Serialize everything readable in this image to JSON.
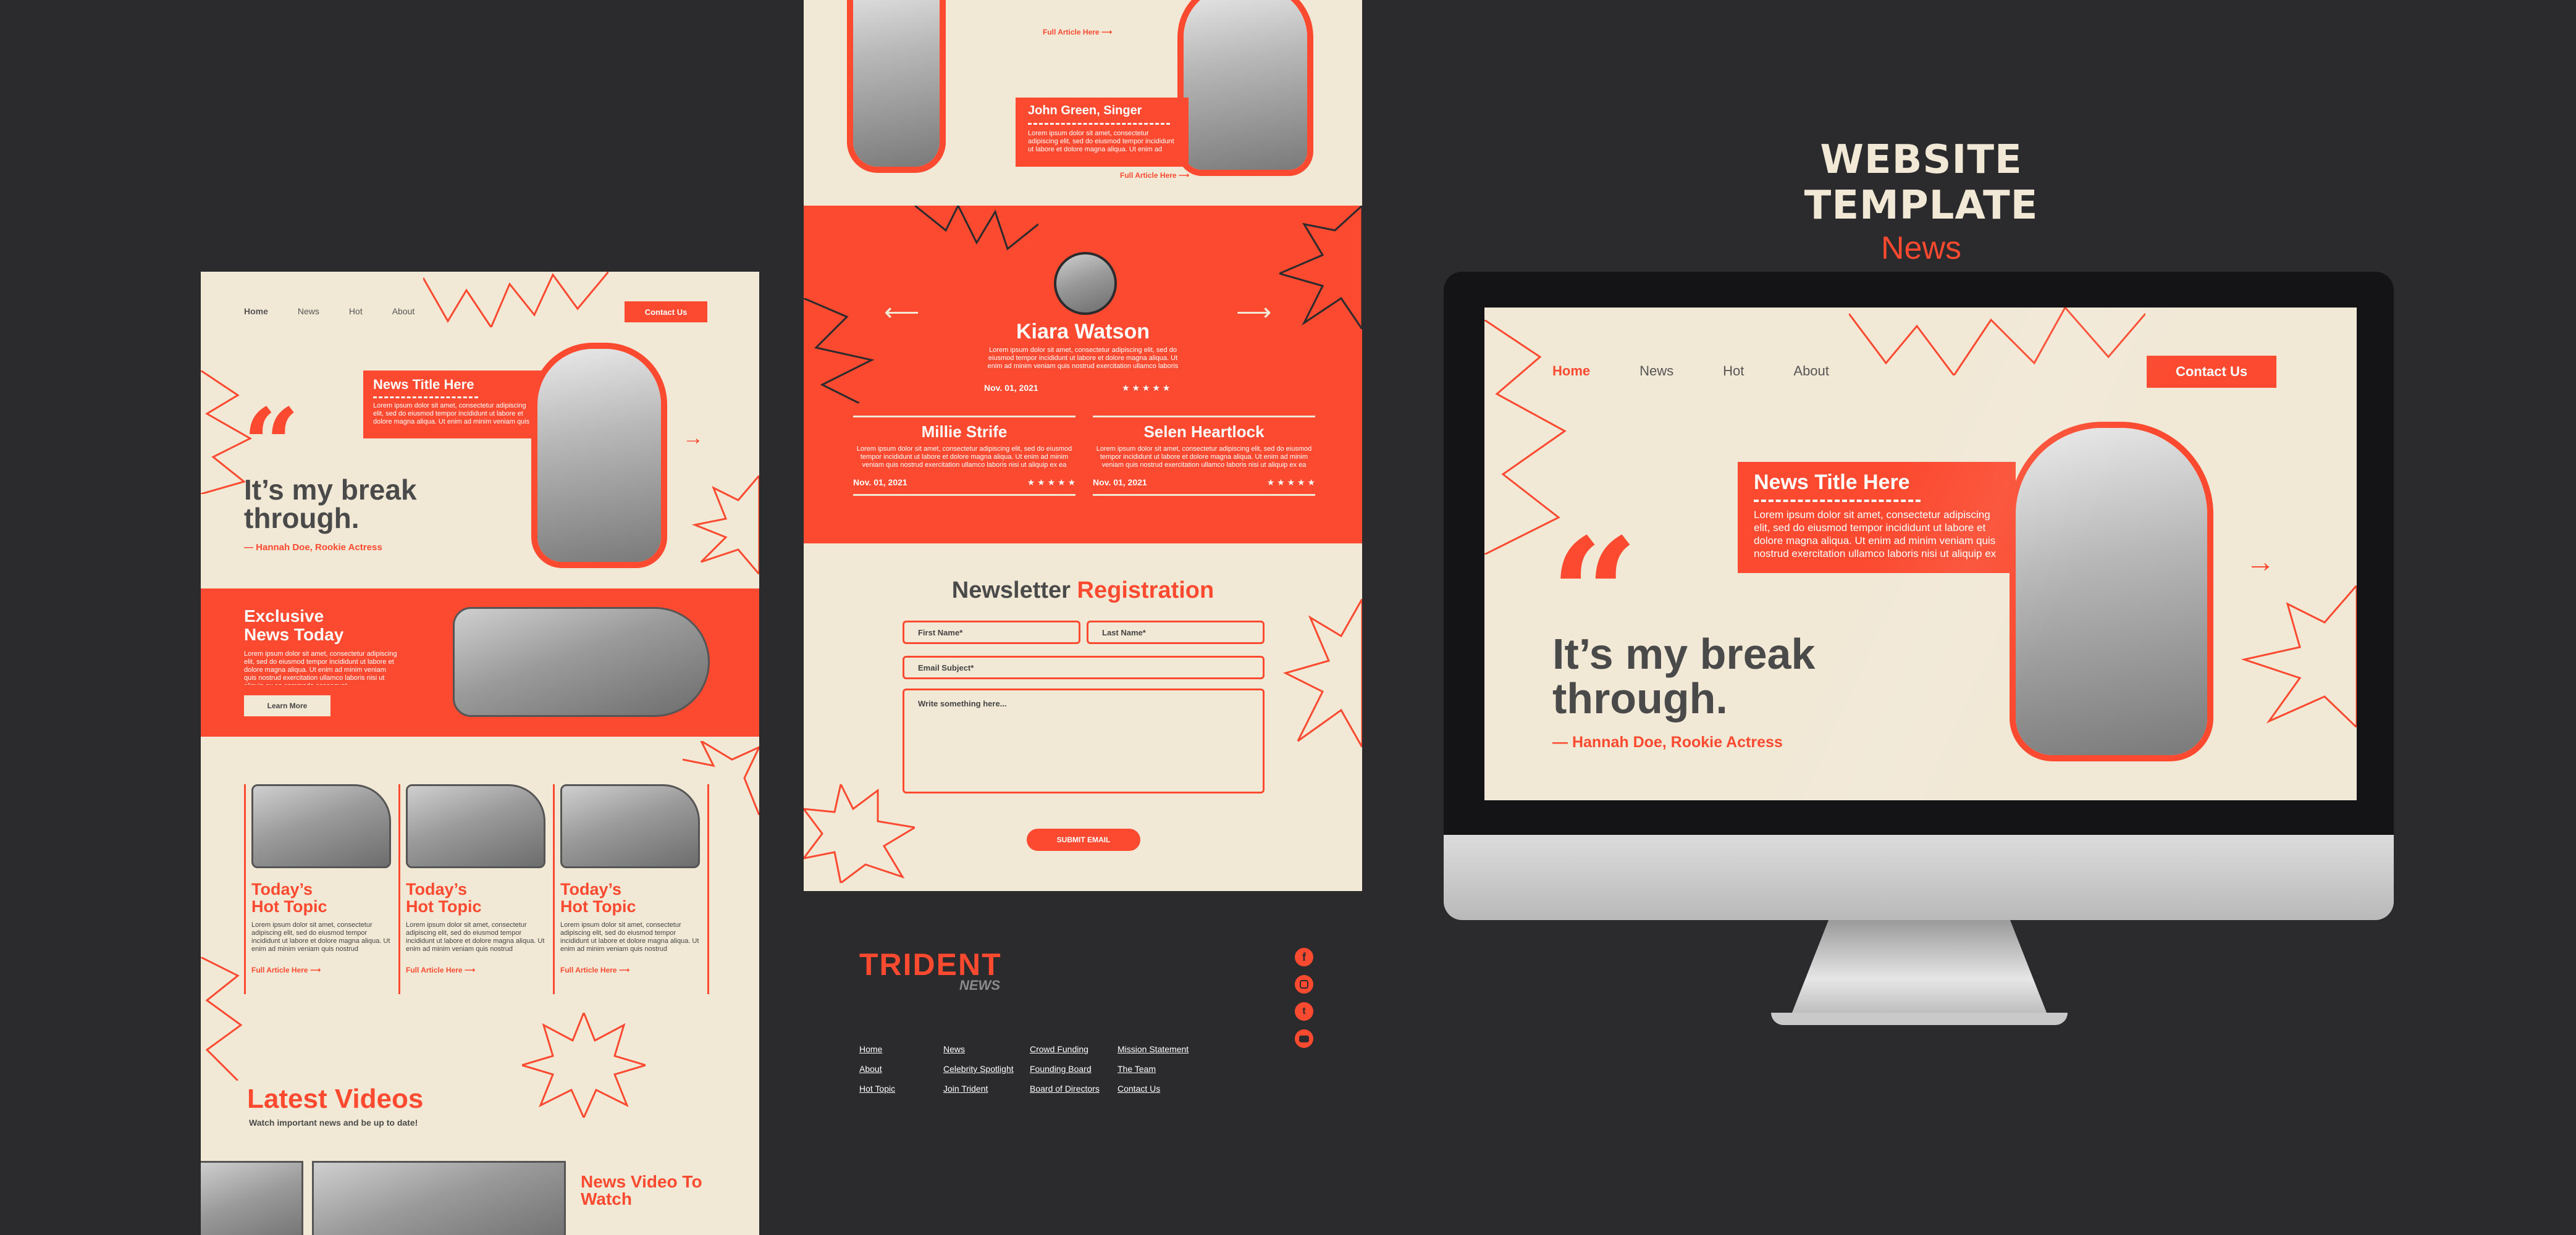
{
  "title": {
    "main": "WEBSITE TEMPLATE",
    "sub": "News"
  },
  "colors": {
    "accent": "#fb4a30",
    "cream": "#f1e8d6",
    "dark": "#2b2a2d"
  },
  "left": {
    "nav": [
      "Home",
      "News",
      "Hot",
      "About"
    ],
    "contact": "Contact Us",
    "news_title": "News Title Here",
    "lorem": "Lorem ipsum dolor sit amet, consectetur adipiscing elit, sed do eiusmod tempor incididunt ut labore et dolore magna aliqua. Ut enim ad minim veniam quis nostrud exercitation ullamco laboris nisi ut aliquip ex ea commodo consequat.",
    "quote_mark": "“",
    "quote": "It’s my break through.",
    "attribution": "— Hannah Doe, Rookie Actress",
    "exclusive_title": "Exclusive News Today",
    "learn_more": "Learn More",
    "hot_topics": [
      {
        "title": "Today’s Hot Topic",
        "link": "Full Article Here"
      },
      {
        "title": "Today’s Hot Topic",
        "link": "Full Article Here"
      },
      {
        "title": "Today’s Hot Topic",
        "link": "Full Article Here"
      }
    ],
    "latest_videos": "Latest Videos",
    "latest_sub": "Watch important news and be up to date!",
    "video_title": "News Video To Watch"
  },
  "middle": {
    "top_link_1": "Full Article Here",
    "singer": "John Green, Singer",
    "top_link_2": "Full Article Here",
    "testimonial_name": "Kiara Watson",
    "testimonial_date": "Nov. 01, 2021",
    "stars": "★ ★ ★ ★ ★",
    "reviews": [
      {
        "name": "Millie Strife",
        "date": "Nov. 01, 2021",
        "stars": "★ ★ ★ ★ ★"
      },
      {
        "name": "Selen Heartlock",
        "date": "Nov. 01, 2021",
        "stars": "★ ★ ★ ★ ★"
      }
    ],
    "newsletter_1": "Newsletter",
    "newsletter_2": "Registration",
    "first_name": "First Name*",
    "last_name": "Last Name*",
    "email": "Email Subject*",
    "message": "Write something here...",
    "submit": "SUBMIT EMAIL",
    "brand": "TRIDENT",
    "brand_sub": "NEWS",
    "footer_cols": [
      [
        "Home",
        "About",
        "Hot Topic"
      ],
      [
        "News",
        "Celebrity Spotlight",
        "Join Trident"
      ],
      [
        "Crowd Funding",
        "Founding Board",
        "Board of Directors"
      ],
      [
        "Mission Statement",
        "The Team",
        "Contact Us"
      ]
    ],
    "social_icons": [
      "facebook-icon",
      "instagram-icon",
      "twitter-icon",
      "youtube-icon"
    ]
  },
  "monitor": {
    "nav": [
      "Home",
      "News",
      "Hot",
      "About"
    ],
    "contact": "Contact Us",
    "news_title": "News Title Here",
    "lorem": "Lorem ipsum dolor sit amet, consectetur adipiscing elit, sed do eiusmod tempor incididunt ut labore et dolore magna aliqua. Ut enim ad minim veniam quis nostrud exercitation ullamco laboris nisi ut aliquip ex ea commodo consequat.",
    "quote_mark": "“",
    "quote": "It’s my break through.",
    "attribution": "— Hannah Doe, Rookie Actress"
  }
}
